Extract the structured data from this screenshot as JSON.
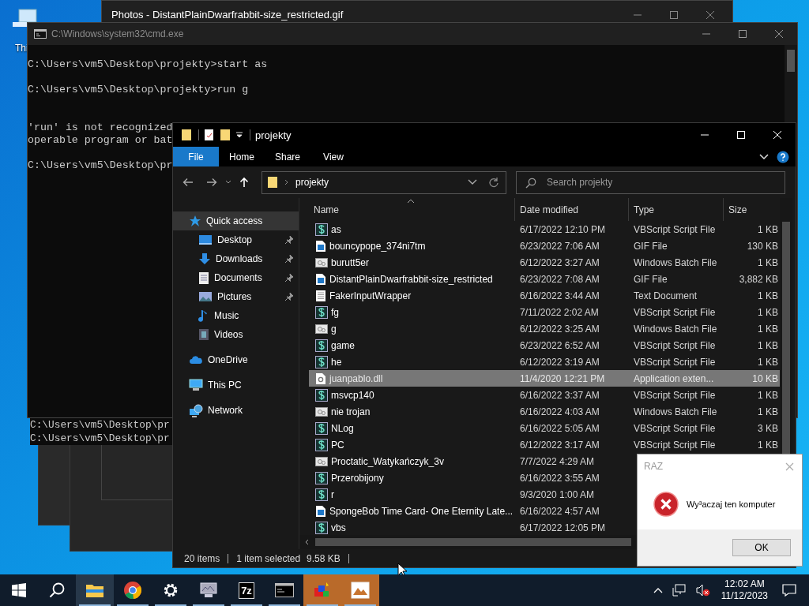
{
  "desktop_icons": [
    {
      "label": "Thi"
    }
  ],
  "photos_window": {
    "title": "Photos - DistantPlainDwarfrabbit-size_restricted.gif"
  },
  "cmd_window": {
    "title": "C:\\Windows\\system32\\cmd.exe",
    "blocks": [
      {
        "kind": "command",
        "lines": [
          "C:\\Users\\vm5\\Desktop\\projekty>start as"
        ]
      },
      {
        "kind": "command",
        "lines": [
          "C:\\Users\\vm5\\Desktop\\projekty>run g"
        ]
      },
      {
        "kind": "error",
        "lines": [
          "'run' is not recognized",
          "operable program or bat"
        ]
      },
      {
        "kind": "command",
        "lines": [
          "C:\\Users\\vm5\\Desktop\\pr"
        ]
      }
    ],
    "trail_lines": [
      "C:\\Users\\vm5\\Desktop\\pr",
      "C:\\Users\\vm5\\Desktop\\pr"
    ]
  },
  "explorer": {
    "title": "projekty",
    "ribbon_tabs": [
      {
        "label": "File",
        "selected": true
      },
      {
        "label": "Home",
        "selected": false
      },
      {
        "label": "Share",
        "selected": false
      },
      {
        "label": "View",
        "selected": false
      }
    ],
    "address": "projekty",
    "search": {
      "placeholder": "Search projekty"
    },
    "nav": [
      {
        "label": "Quick access",
        "kind": "star",
        "selected": true,
        "children": [
          {
            "label": "Desktop",
            "kind": "desktop",
            "selected": false,
            "pinned": true
          },
          {
            "label": "Downloads",
            "kind": "downloads",
            "selected": false,
            "pinned": true
          },
          {
            "label": "Documents",
            "kind": "documents",
            "selected": false,
            "pinned": true
          },
          {
            "label": "Pictures",
            "kind": "pictures",
            "selected": false,
            "pinned": true
          },
          {
            "label": "Music",
            "kind": "music",
            "selected": false,
            "pinned": false
          },
          {
            "label": "Videos",
            "kind": "videos",
            "selected": false,
            "pinned": false
          }
        ]
      },
      {
        "label": "OneDrive",
        "kind": "cloud",
        "selected": false
      },
      {
        "label": "This PC",
        "kind": "pc",
        "selected": false
      },
      {
        "label": "Network",
        "kind": "network",
        "selected": false
      }
    ],
    "columns": [
      "Name",
      "Date modified",
      "Type",
      "Size"
    ],
    "rows": [
      {
        "name": "as",
        "date": "6/17/2022 12:10 PM",
        "type": "VBScript Script File",
        "size": "1 KB",
        "kind": "vbs",
        "selected": false
      },
      {
        "name": "bouncypope_374ni7tm",
        "date": "6/23/2022 7:06 AM",
        "type": "GIF File",
        "size": "130 KB",
        "kind": "gif",
        "selected": false
      },
      {
        "name": "burutt5er",
        "date": "6/12/2022 3:27 AM",
        "type": "Windows Batch File",
        "size": "1 KB",
        "kind": "bat",
        "selected": false
      },
      {
        "name": "DistantPlainDwarfrabbit-size_restricted",
        "date": "6/23/2022 7:08 AM",
        "type": "GIF File",
        "size": "3,882 KB",
        "kind": "gif",
        "selected": false
      },
      {
        "name": "FakerInputWrapper",
        "date": "6/16/2022 3:44 AM",
        "type": "Text Document",
        "size": "1 KB",
        "kind": "txt",
        "selected": false
      },
      {
        "name": "fg",
        "date": "7/11/2022 2:02 AM",
        "type": "VBScript Script File",
        "size": "1 KB",
        "kind": "vbs",
        "selected": false
      },
      {
        "name": "g",
        "date": "6/12/2022 3:25 AM",
        "type": "Windows Batch File",
        "size": "1 KB",
        "kind": "bat",
        "selected": false
      },
      {
        "name": "game",
        "date": "6/23/2022 6:52 AM",
        "type": "VBScript Script File",
        "size": "1 KB",
        "kind": "vbs",
        "selected": false
      },
      {
        "name": "he",
        "date": "6/12/2022 3:19 AM",
        "type": "VBScript Script File",
        "size": "1 KB",
        "kind": "vbs",
        "selected": false
      },
      {
        "name": "juanpablo.dll",
        "date": "11/4/2020 12:21 PM",
        "type": "Application exten...",
        "size": "10 KB",
        "kind": "dll",
        "selected": true
      },
      {
        "name": "msvcp140",
        "date": "6/16/2022 3:37 AM",
        "type": "VBScript Script File",
        "size": "1 KB",
        "kind": "vbs",
        "selected": false
      },
      {
        "name": "nie trojan",
        "date": "6/16/2022 4:03 AM",
        "type": "Windows Batch File",
        "size": "1 KB",
        "kind": "bat",
        "selected": false
      },
      {
        "name": "NLog",
        "date": "6/16/2022 5:05 AM",
        "type": "VBScript Script File",
        "size": "3 KB",
        "kind": "vbs",
        "selected": false
      },
      {
        "name": "PC",
        "date": "6/12/2022 3:17 AM",
        "type": "VBScript Script File",
        "size": "1 KB",
        "kind": "vbs",
        "selected": false
      },
      {
        "name": "Proctatic_Watykańczyk_3v",
        "date": "7/7/2022 4:29 AM",
        "kind": "bat",
        "selected": false
      },
      {
        "name": "Przerobijony",
        "date": "6/16/2022 3:55 AM",
        "kind": "vbs",
        "selected": false
      },
      {
        "name": "r",
        "date": "9/3/2020 1:00 AM",
        "kind": "vbs",
        "selected": false
      },
      {
        "name": "SpongeBob Time Card- One Eternity Late...",
        "date": "6/16/2022 4:57 AM",
        "kind": "gif",
        "selected": false
      },
      {
        "name": "vbs",
        "date": "6/17/2022 12:05 PM",
        "kind": "vbs",
        "selected": false
      }
    ],
    "status": {
      "count": "20 items",
      "selection": "1 item selected",
      "size": "9.58 KB"
    }
  },
  "dialog": {
    "title": "RAZ",
    "message": "Wy³aczaj ten komputer",
    "button": "OK"
  },
  "taskbar": {
    "items": [
      {
        "kind": "start",
        "running": false,
        "flashing": false
      },
      {
        "kind": "search",
        "running": false,
        "flashing": false
      },
      {
        "kind": "folder",
        "running": true,
        "flashing": false
      },
      {
        "kind": "browser",
        "running": true,
        "flashing": false
      },
      {
        "kind": "gear",
        "running": true,
        "flashing": false
      },
      {
        "kind": "computer",
        "running": true,
        "flashing": false
      },
      {
        "kind": "archive",
        "label": "7z",
        "running": true,
        "flashing": false
      },
      {
        "kind": "terminal",
        "running": true,
        "flashing": false
      },
      {
        "kind": "blocks",
        "running": true,
        "flashing": true
      },
      {
        "kind": "photo",
        "running": true,
        "flashing": true
      }
    ],
    "time": "12:02 AM",
    "date": "11/12/2023"
  }
}
